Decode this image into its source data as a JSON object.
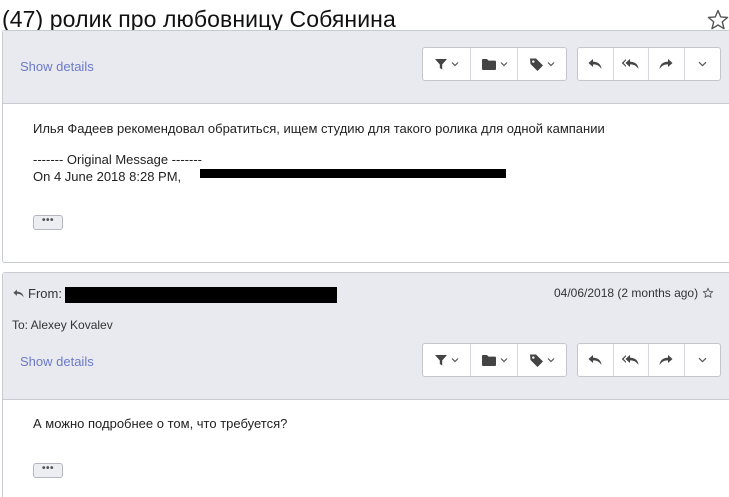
{
  "subject": "(47) ролик про любовницу Собянина",
  "toolbar": {
    "icons": [
      "filter-icon",
      "folder-icon",
      "tag-icon",
      "reply-icon",
      "reply-all-icon",
      "forward-icon",
      "more-icon"
    ]
  },
  "message1": {
    "show_details": "Show details",
    "body_line": "Илья Фадеев рекомендовал обратиться, ищем студию для такого ролика для одной кампании",
    "original_header": "------- Original Message -------",
    "quote_line": "On 4 June 2018 8:28 PM,",
    "ellipsis": "•••"
  },
  "message2": {
    "from_label": "From:",
    "to_line": "To: Alexey Kovalev",
    "date": "04/06/2018 (2 months ago)",
    "show_details": "Show details",
    "body_line": "А можно подробнее о том, что требуется?",
    "ellipsis": "•••"
  },
  "colors": {
    "header_bg": "#e9eaf0",
    "link": "#6b79c9",
    "border": "#c9cbd3",
    "redaction": "#000000"
  }
}
